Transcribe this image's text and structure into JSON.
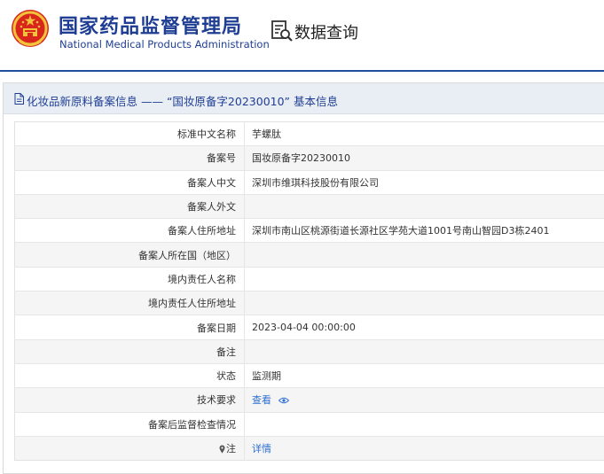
{
  "header": {
    "brand_cn": "国家药品监督管理局",
    "brand_en": "National Medical Products Administration",
    "query_label": "数据查询",
    "brand_color": "#1f3e93"
  },
  "panel": {
    "title": "化妆品新原料备案信息 —— “国妆原备字20230010” 基本信息"
  },
  "rows": [
    {
      "label": "标准中文名称",
      "value": "芋螺肽"
    },
    {
      "label": "备案号",
      "value": "国妆原备字20230010"
    },
    {
      "label": "备案人中文",
      "value": "深圳市维琪科技股份有限公司"
    },
    {
      "label": "备案人外文",
      "value": ""
    },
    {
      "label": "备案人住所地址",
      "value": "深圳市南山区桃源街道长源社区学苑大道1001号南山智园D3栋2401"
    },
    {
      "label": "备案人所在国（地区）",
      "value": ""
    },
    {
      "label": "境内责任人名称",
      "value": ""
    },
    {
      "label": "境内责任人住所地址",
      "value": ""
    },
    {
      "label": "备案日期",
      "value": "2023-04-04 00:00:00"
    },
    {
      "label": "备注",
      "value": ""
    },
    {
      "label": "状态",
      "value": "监测期"
    },
    {
      "label": "技术要求",
      "value": "查看"
    },
    {
      "label": "备案后监督检查情况",
      "value": ""
    },
    {
      "label": "注",
      "value": "详情"
    }
  ],
  "icons": {
    "emblem": "national-emblem-icon",
    "query": "data-query-icon",
    "doc": "document-icon",
    "eye": "eye-icon",
    "pin": "pin-icon"
  },
  "colors": {
    "link": "#2f6fd0",
    "header_line": "#1f4e9e",
    "panel_title_bg": "#e9eef5"
  }
}
